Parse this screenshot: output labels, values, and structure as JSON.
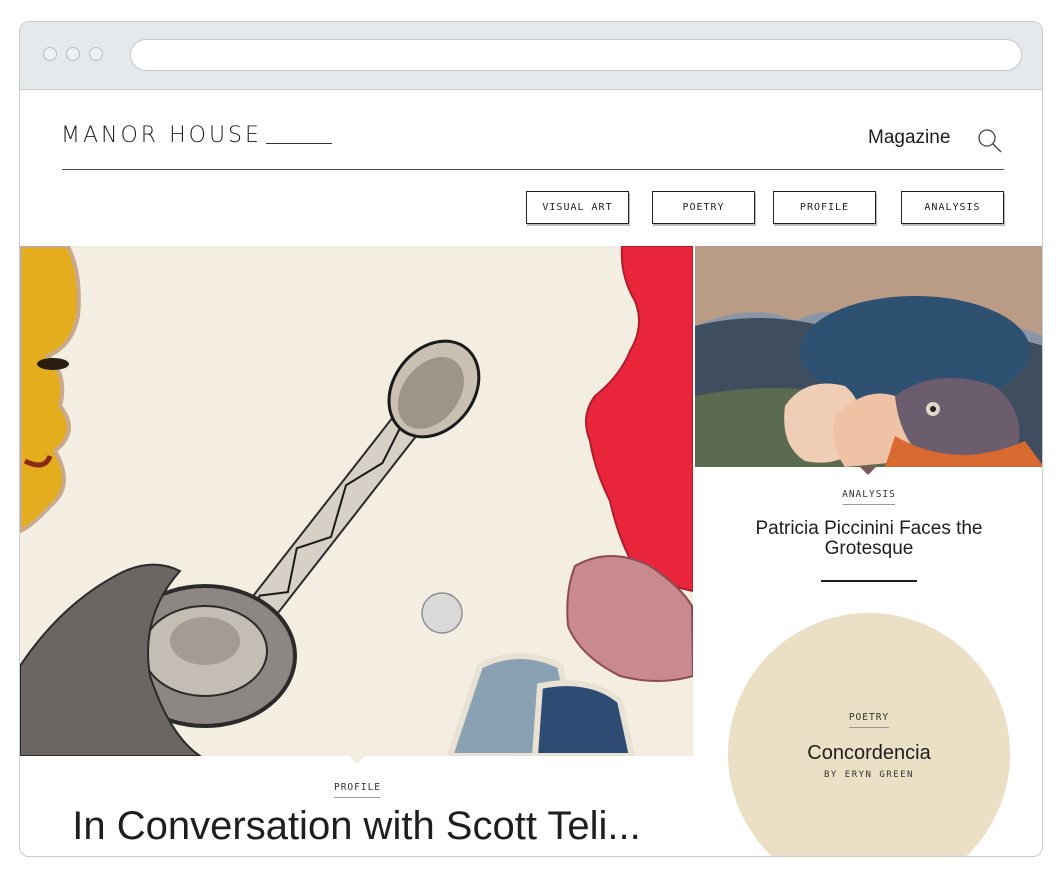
{
  "header": {
    "brand": "MANOR HOUSE",
    "nav_label": "Magazine"
  },
  "icons": {
    "search": "search-icon"
  },
  "categories": [
    "VISUAL ART",
    "POETRY",
    "PROFILE",
    "ANALYSIS"
  ],
  "hero_article": {
    "kicker": "PROFILE",
    "title": "In Conversation with Scott Teli..."
  },
  "side_article": {
    "kicker": "ANALYSIS",
    "title": "Patricia Piccinini Faces the Grotesque"
  },
  "poetry_article": {
    "kicker": "POETRY",
    "title": "Concordencia",
    "byline": "BY ERYN GREEN"
  },
  "colors": {
    "accent_cream": "#ebdfc5",
    "hero_red": "#e8253a",
    "hero_yellow": "#e8b220"
  }
}
